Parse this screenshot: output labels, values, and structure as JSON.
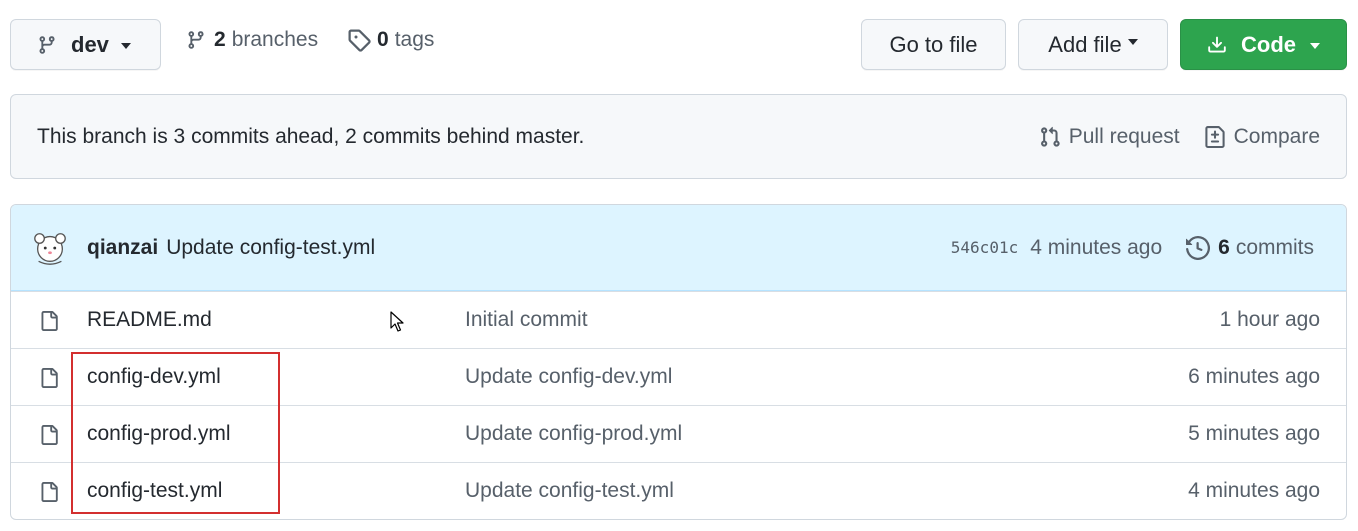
{
  "toolbar": {
    "branch_label": "dev",
    "branches_count": "2",
    "branches_label": "branches",
    "tags_count": "0",
    "tags_label": "tags",
    "goto_file_label": "Go to file",
    "add_file_label": "Add file",
    "code_label": "Code"
  },
  "branch_status": {
    "message": "This branch is 3 commits ahead, 2 commits behind master.",
    "pull_request_label": "Pull request",
    "compare_label": "Compare"
  },
  "latest_commit": {
    "author": "qianzai",
    "message": "Update config-test.yml",
    "sha": "546c01c",
    "time": "4 minutes ago",
    "commits_count": "6",
    "commits_label": "commits"
  },
  "files": [
    {
      "name": "README.md",
      "message": "Initial commit",
      "time": "1 hour ago"
    },
    {
      "name": "config-dev.yml",
      "message": "Update config-dev.yml",
      "time": "6 minutes ago"
    },
    {
      "name": "config-prod.yml",
      "message": "Update config-prod.yml",
      "time": "5 minutes ago"
    },
    {
      "name": "config-test.yml",
      "message": "Update config-test.yml",
      "time": "4 minutes ago"
    }
  ],
  "icons": {
    "branch": "git-branch-icon",
    "tag": "tag-icon",
    "download": "download-icon",
    "pull_request": "git-pull-request-icon",
    "compare": "file-diff-icon",
    "history": "history-icon",
    "file": "file-icon"
  },
  "colors": {
    "code_button": "#2da44e",
    "commit_header_bg": "#ddf4ff",
    "highlight_box": "#d32f2f"
  }
}
